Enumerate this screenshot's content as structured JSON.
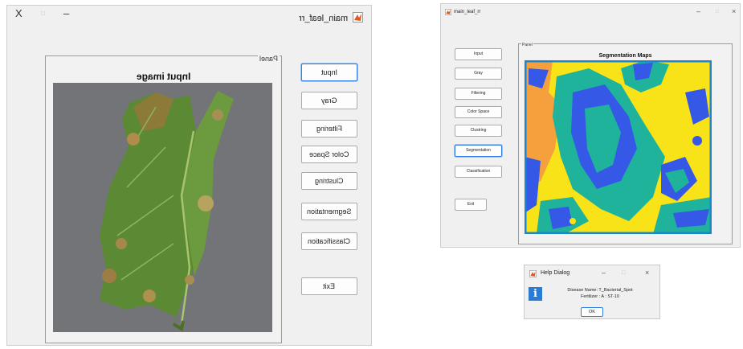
{
  "left_window": {
    "title": "main_leaf_rr",
    "controls": {
      "minimize": "–",
      "maximize": "□",
      "close": "X"
    },
    "panel_label": "Panel",
    "image_title": "Input image",
    "buttons": [
      "Input",
      "Gray",
      "Filtering",
      "Color Space",
      "Clustring",
      "Segmentation",
      "Classification",
      "Exit"
    ],
    "selected": "Input"
  },
  "right_window": {
    "title": "main_leaf_rr",
    "controls": {
      "minimize": "–",
      "maximize": "□",
      "close": "×"
    },
    "panel_label": "Panel",
    "image_title": "Segmentation Maps",
    "buttons": [
      "Input",
      "Gray",
      "Filtering",
      "Color Space",
      "Clustring",
      "Segmentation",
      "Classification",
      "Exit"
    ],
    "selected": "Segmentation"
  },
  "help_dialog": {
    "title": "Help Dialog",
    "controls": {
      "minimize": "–",
      "maximize": "□",
      "close": "×"
    },
    "icon": "info-icon",
    "line1": "Disease Name: T_Bacterial_Spot",
    "line2": "Fertilizer : A : ST-10",
    "ok_label": "OK"
  },
  "colors": {
    "segment_yellow": "#f7e317",
    "segment_teal": "#1fb39c",
    "segment_blue": "#3559e6",
    "segment_orange": "#f5a03d",
    "segment_border": "#1d85c8",
    "selection_blue": "#2f7de0"
  }
}
